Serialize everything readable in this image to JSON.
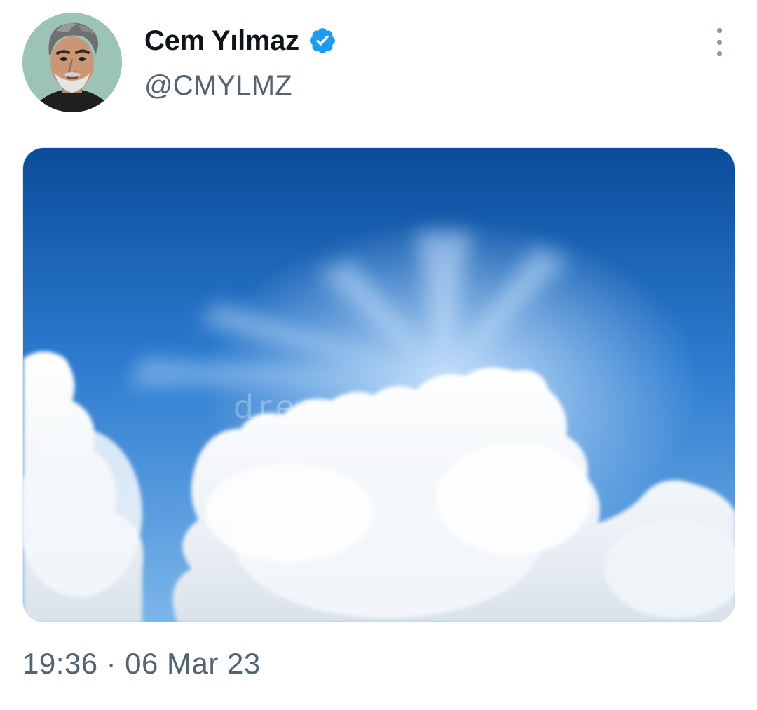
{
  "tweet": {
    "author": {
      "display_name": "Cem Yılmaz",
      "handle": "@CMYLMZ",
      "verified": true,
      "verified_icon": "verified-badge-icon",
      "avatar_icon": "avatar-illustrated-portrait"
    },
    "more_icon": "more-vertical-icon",
    "media": {
      "description_icon": "sky-clouds-photo",
      "watermark": "dreamstime"
    },
    "time": "19:36",
    "separator": "·",
    "date": "06 Mar 23"
  },
  "colors": {
    "name": "#0f1419",
    "secondary": "#536471",
    "verified": "#1d9bf0",
    "divider": "#e6ebef"
  }
}
